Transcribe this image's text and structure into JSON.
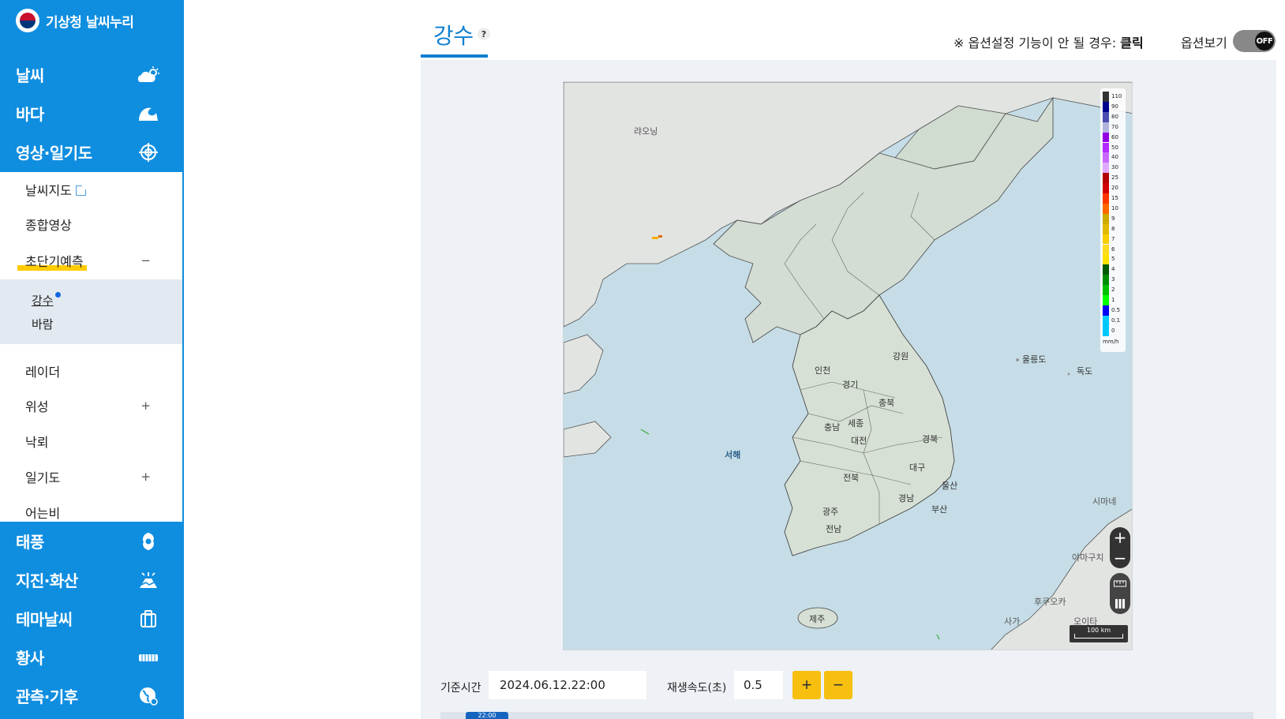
{
  "app": {
    "name": "기상청 날씨누리"
  },
  "sidebar": {
    "main_top": [
      {
        "label": "날씨",
        "icon": "cloud-sun-icon"
      },
      {
        "label": "바다",
        "icon": "wave-icon"
      },
      {
        "label": "영상·일기도",
        "icon": "satellite-icon"
      }
    ],
    "sub": [
      {
        "label": "날씨지도",
        "external": true
      },
      {
        "label": "종합영상"
      },
      {
        "label": "초단기예측",
        "toggle": "−"
      },
      {
        "label": "레이더"
      },
      {
        "label": "위성",
        "toggle": "+"
      },
      {
        "label": "낙뢰"
      },
      {
        "label": "일기도",
        "toggle": "+"
      },
      {
        "label": "어는비"
      }
    ],
    "subsub": [
      {
        "label": "강수",
        "active": true
      },
      {
        "label": "바람"
      }
    ],
    "main_bottom": [
      {
        "label": "태풍",
        "icon": "typhoon-icon"
      },
      {
        "label": "지진·화산",
        "icon": "volcano-icon"
      },
      {
        "label": "테마날씨",
        "icon": "suitcase-icon"
      },
      {
        "label": "황사",
        "icon": "dust-icon"
      },
      {
        "label": "관측·기후",
        "icon": "globe-icon"
      }
    ]
  },
  "header": {
    "title": "강수",
    "help": "?",
    "note_prefix": "※ 옵션설정 기능이 안 될 경우:",
    "note_link": "클릭",
    "option_label": "옵션보기",
    "toggle_state": "OFF"
  },
  "map": {
    "legend_unit": "mm/h",
    "legend": [
      {
        "label": "110",
        "color": "#333333"
      },
      {
        "label": "90",
        "color": "#000390"
      },
      {
        "label": "80",
        "color": "#4c4eb1"
      },
      {
        "label": "70",
        "color": "#b3b4de"
      },
      {
        "label": "60",
        "color": "#9300e4"
      },
      {
        "label": "50",
        "color": "#b329ff"
      },
      {
        "label": "40",
        "color": "#c969ff"
      },
      {
        "label": "30",
        "color": "#e0a9ff"
      },
      {
        "label": "25",
        "color": "#b40000"
      },
      {
        "label": "20",
        "color": "#d20000"
      },
      {
        "label": "15",
        "color": "#ff3300"
      },
      {
        "label": "10",
        "color": "#ff6600"
      },
      {
        "label": "9",
        "color": "#ccaa00"
      },
      {
        "label": "8",
        "color": "#e0b900"
      },
      {
        "label": "7",
        "color": "#f9cd00"
      },
      {
        "label": "6",
        "color": "#ffdc1f"
      },
      {
        "label": "5",
        "color": "#ffe100"
      },
      {
        "label": "4",
        "color": "#005a00"
      },
      {
        "label": "3",
        "color": "#008c00"
      },
      {
        "label": "2",
        "color": "#00be00"
      },
      {
        "label": "1",
        "color": "#00ff00"
      },
      {
        "label": "0.5",
        "color": "#0000f6"
      },
      {
        "label": "0.1",
        "color": "#00c8ff"
      },
      {
        "label": "0",
        "color": "#00c8ff"
      }
    ],
    "labels": {
      "laoning": "랴오닝",
      "yellow_sea": "서해",
      "gangwon": "강원",
      "gyeonggi": "경기",
      "incheon": "인천",
      "chungbuk": "충북",
      "chungnam": "충남",
      "sejong": "세종",
      "daejeon": "대전",
      "gyeongbuk": "경북",
      "daegu": "대구",
      "ulsan": "울산",
      "jeonbuk": "전북",
      "gyeongnam": "경남",
      "busan": "부산",
      "gwangju": "광주",
      "jeonnam": "전남",
      "jeju": "제주",
      "ulleungdo": "울릉도",
      "dokdo": "독도",
      "shimane": "시마네",
      "yamaguchi": "야마구치",
      "fukuoka": "후쿠오카",
      "oita": "오이타",
      "saga": "사가"
    },
    "zoom_in": "+",
    "zoom_out": "−",
    "scale": "100 km"
  },
  "controls": {
    "base_time_label": "기준시간",
    "base_time_value": "2024.06.12.22:00",
    "speed_label": "재생속도(초)",
    "speed_value": "0.5",
    "plus": "+",
    "minus": "−",
    "timeline_marker": "22:00"
  }
}
